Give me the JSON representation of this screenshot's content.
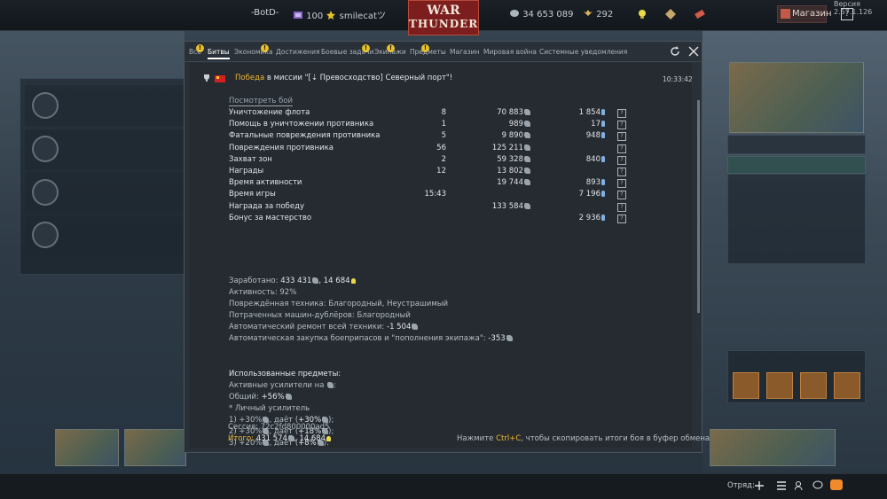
{
  "topbar": {
    "squad_tag": "-BotD-",
    "level": "100",
    "username": "smilecatツ",
    "logo_line1": "WAR",
    "logo_line2": "THUNDER",
    "silver_lions": "34 653 089",
    "golden_eagles": "292",
    "shop_label": "Магазин",
    "help_label": "?",
    "version": "Версия 2.57.1.126"
  },
  "tabs": [
    {
      "label": "Все",
      "warn": true
    },
    {
      "label": "Битвы",
      "active": true
    },
    {
      "label": "Экономика",
      "warn": true
    },
    {
      "label": "Достижения"
    },
    {
      "label": "Боевые задачи",
      "warn": true
    },
    {
      "label": "Экипажи",
      "warn": true
    },
    {
      "label": "Предметы",
      "warn": true
    },
    {
      "label": "Магазин"
    },
    {
      "label": "Мировая война"
    },
    {
      "label": "Системные уведомления"
    }
  ],
  "message": {
    "result": "Победа",
    "text": " в миссии \"[⇣ Превосходство] Северный порт\"!",
    "time": "10:33:42",
    "view_battle": "Посмотреть бой",
    "rows": [
      {
        "name": "Уничтожение флота",
        "count": "8",
        "lions": "70 883",
        "rp": "1 854"
      },
      {
        "name": "Помощь в уничтожении противника",
        "count": "1",
        "lions": "989",
        "rp": "17"
      },
      {
        "name": "Фатальные повреждения противника",
        "count": "5",
        "lions": "9 890",
        "rp": "948"
      },
      {
        "name": "Повреждения противника",
        "count": "56",
        "lions": "125 211",
        "rp": ""
      },
      {
        "name": "Захват зон",
        "count": "2",
        "lions": "59 328",
        "rp": "840"
      },
      {
        "name": "Награды",
        "count": "12",
        "lions": "13 802",
        "rp": ""
      },
      {
        "name": "Время активности",
        "count": "",
        "lions": "19 744",
        "rp": "893"
      },
      {
        "name": "Время игры",
        "count": "15:43",
        "lions": "",
        "rp": "7 196"
      },
      {
        "name": "Награда за победу",
        "count": "",
        "lions": "133 584",
        "rp": ""
      },
      {
        "name": "Бонус за мастерство",
        "count": "",
        "lions": "",
        "rp": "2 936"
      }
    ],
    "earned_label": "Заработано: ",
    "earned_lions": "433 431",
    "earned_rp": "14 684",
    "activity": "Активность: 92%",
    "damaged": "Повреждённая техника: Благородный, Неустрашимый",
    "spent_backup": "Потраченных машин-дублёров: Благородный",
    "repair_label": "Автоматический ремонт всей техники: ",
    "repair_value": "-1 504",
    "restock_label": "Автоматическая закупка боеприпасов и \"пополнения экипажа\": ",
    "restock_value": "-353",
    "used_items": "Использованные предметы:",
    "boosters": "Активные усилители на ",
    "general_label": "Общий: ",
    "general_value": "+56%",
    "personal": "* Личный усилитель",
    "b1": "1) +30%",
    "b1_gives": ", даёт (",
    "b1_val": "+30%",
    "b1_end": ");",
    "b2": "2) +30%",
    "b2_val": "+18%",
    "b2_end": ");",
    "b3": "3) +20%",
    "b3_val": "+8%",
    "b3_end": ").",
    "session": "Сессия: 72c2fd800000ad5",
    "total_label": "Итого: ",
    "total_lions": "431 574",
    "total_rp": "14 684",
    "hint_pre": "Нажмите ",
    "hint_key": "Ctrl+C",
    "hint_post": ", чтобы скопировать итоги боя в буфер обмена"
  },
  "bottombar": {
    "squad_label": "Отряд:"
  },
  "colors": {
    "accent": "#f0b732",
    "dialog_bg": "#2a3037",
    "warn": "#e8c22a",
    "logo": "#7c1e1e"
  }
}
